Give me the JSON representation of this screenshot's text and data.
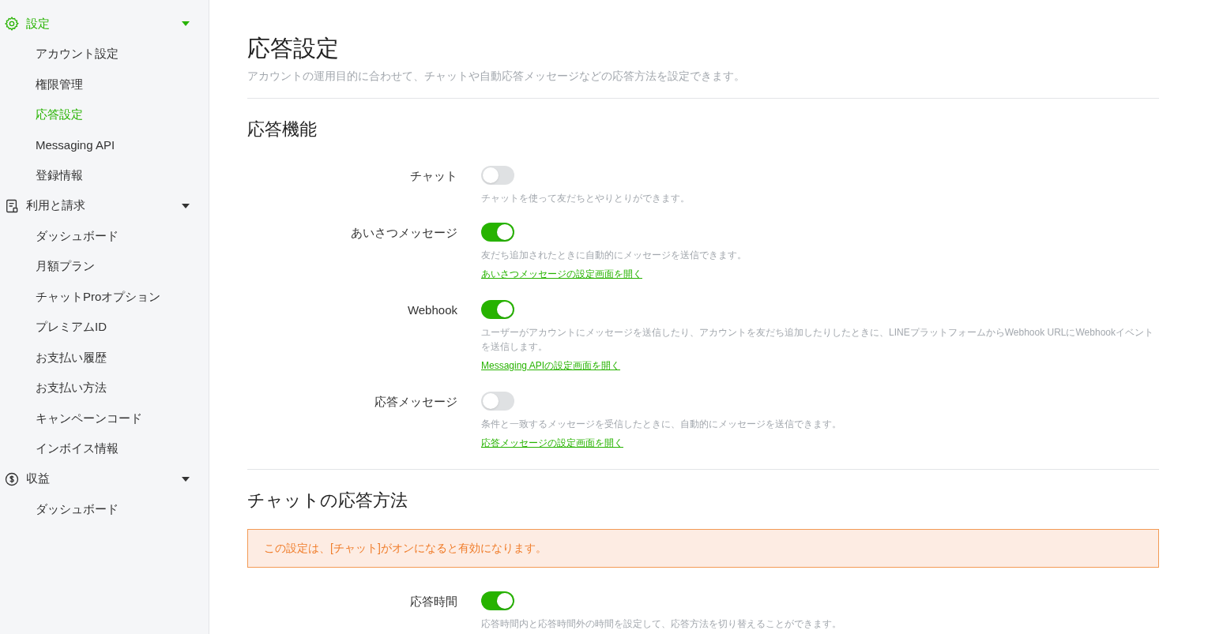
{
  "sidebar": {
    "groups": [
      {
        "label": "設定",
        "selected": true,
        "expanded": true,
        "items": [
          {
            "label": "アカウント設定",
            "selected": false
          },
          {
            "label": "権限管理",
            "selected": false
          },
          {
            "label": "応答設定",
            "selected": true
          },
          {
            "label": "Messaging API",
            "selected": false
          },
          {
            "label": "登録情報",
            "selected": false
          }
        ]
      },
      {
        "label": "利用と請求",
        "selected": false,
        "expanded": true,
        "items": [
          {
            "label": "ダッシュボード",
            "selected": false
          },
          {
            "label": "月額プラン",
            "selected": false
          },
          {
            "label": "チャットProオプション",
            "selected": false
          },
          {
            "label": "プレミアムID",
            "selected": false
          },
          {
            "label": "お支払い履歴",
            "selected": false
          },
          {
            "label": "お支払い方法",
            "selected": false
          },
          {
            "label": "キャンペーンコード",
            "selected": false
          },
          {
            "label": "インボイス情報",
            "selected": false
          }
        ]
      },
      {
        "label": "収益",
        "selected": false,
        "expanded": true,
        "items": [
          {
            "label": "ダッシュボード",
            "selected": false
          }
        ]
      }
    ]
  },
  "page": {
    "title": "応答設定",
    "description": "アカウントの運用目的に合わせて、チャットや自動応答メッセージなどの応答方法を設定できます。"
  },
  "sections": [
    {
      "title": "応答機能",
      "settings": [
        {
          "label": "チャット",
          "on": false,
          "description": "チャットを使って友だちとやりとりができます。"
        },
        {
          "label": "あいさつメッセージ",
          "on": true,
          "description": "友だち追加されたときに自動的にメッセージを送信できます。",
          "link": "あいさつメッセージの設定画面を開く"
        },
        {
          "label": "Webhook",
          "on": true,
          "description": "ユーザーがアカウントにメッセージを送信したり、アカウントを友だち追加したりしたときに、LINEプラットフォームからWebhook URLにWebhookイベントを送信します。",
          "link": "Messaging APIの設定画面を開く"
        },
        {
          "label": "応答メッセージ",
          "on": false,
          "description": "条件と一致するメッセージを受信したときに、自動的にメッセージを送信できます。",
          "link": "応答メッセージの設定画面を開く"
        }
      ]
    },
    {
      "title": "チャットの応答方法",
      "notice": "この設定は、[チャット]がオンになると有効になります。",
      "settings": [
        {
          "label": "応答時間",
          "on": true,
          "description": "応答時間内と応答時間外の時間を設定して、応答方法を切り替えることができます。"
        }
      ]
    }
  ]
}
